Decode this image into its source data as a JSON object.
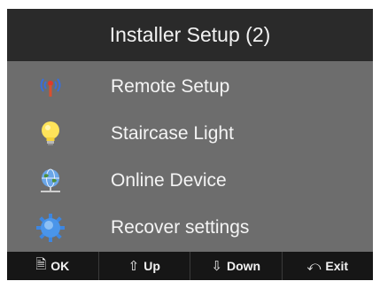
{
  "header": {
    "title": "Installer Setup (2)"
  },
  "menu": {
    "items": [
      {
        "label": "Remote Setup",
        "icon": "antenna-icon"
      },
      {
        "label": "Staircase Light",
        "icon": "lightbulb-icon"
      },
      {
        "label": "Online Device",
        "icon": "globe-network-icon"
      },
      {
        "label": "Recover settings",
        "icon": "gear-icon"
      }
    ]
  },
  "softkeys": {
    "ok": {
      "label": "OK",
      "icon": "document-icon"
    },
    "up": {
      "label": "Up",
      "icon": "arrow-up-icon"
    },
    "down": {
      "label": "Down",
      "icon": "arrow-down-icon"
    },
    "exit": {
      "label": "Exit",
      "icon": "return-icon"
    }
  },
  "colors": {
    "header_bg": "#2a2a2a",
    "menu_bg": "#6d6d6d",
    "softkey_bg": "#161616",
    "text": "#f4f4f4"
  }
}
